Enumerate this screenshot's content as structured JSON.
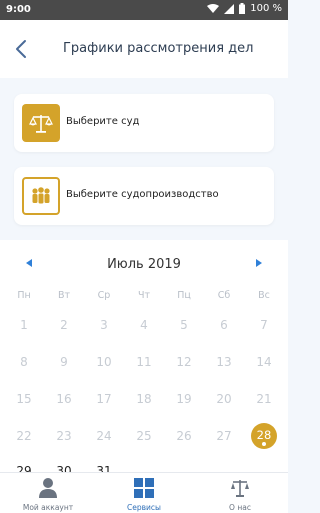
{
  "status_bar": {
    "time": "9:00",
    "battery": "100 %"
  },
  "header": {
    "title": "Графики рассмотрения дел"
  },
  "selectors": [
    {
      "label": "Выберите суд",
      "icon": "scales-icon"
    },
    {
      "label": "Выберите судопроизводство",
      "icon": "people-icon"
    }
  ],
  "calendar": {
    "month": "Июль 2019",
    "weekdays": [
      "Пн",
      "Вт",
      "Ср",
      "Чт",
      "Пц",
      "Сб",
      "Вс"
    ],
    "weeks": [
      [
        "1",
        "2",
        "3",
        "4",
        "5",
        "6",
        "7"
      ],
      [
        "8",
        "9",
        "10",
        "11",
        "12",
        "13",
        "14"
      ],
      [
        "15",
        "16",
        "17",
        "18",
        "19",
        "20",
        "21"
      ],
      [
        "22",
        "23",
        "24",
        "25",
        "26",
        "27",
        "28"
      ],
      [
        "29",
        "30",
        "31",
        "",
        "",
        "",
        ""
      ]
    ],
    "selected_day": "28"
  },
  "bottom_nav": [
    {
      "label": "Мой аккаунт",
      "icon": "account-icon",
      "active": false
    },
    {
      "label": "Сервисы",
      "icon": "services-grid-icon",
      "active": true
    },
    {
      "label": "О нас",
      "icon": "scales-icon",
      "active": false
    }
  ],
  "colors": {
    "accent_gold": "#d4a32a",
    "accent_blue": "#2f6fb8"
  }
}
